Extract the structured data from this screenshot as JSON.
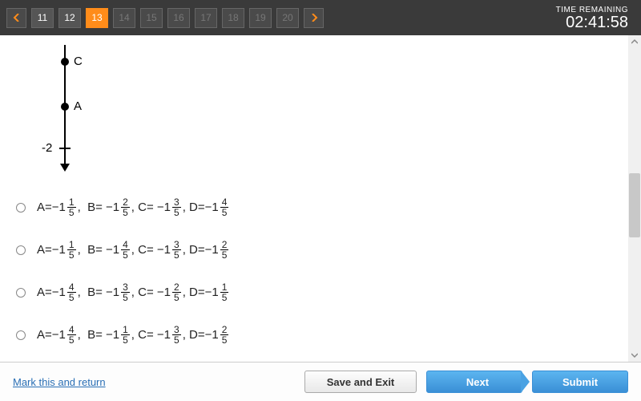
{
  "header": {
    "questions": [
      {
        "num": "11",
        "state": "done"
      },
      {
        "num": "12",
        "state": "done"
      },
      {
        "num": "13",
        "state": "current"
      },
      {
        "num": "14",
        "state": "disabled"
      },
      {
        "num": "15",
        "state": "disabled"
      },
      {
        "num": "16",
        "state": "disabled"
      },
      {
        "num": "17",
        "state": "disabled"
      },
      {
        "num": "18",
        "state": "disabled"
      },
      {
        "num": "19",
        "state": "disabled"
      },
      {
        "num": "20",
        "state": "disabled"
      }
    ],
    "timer_label": "TIME REMAINING",
    "timer_value": "02:41:58"
  },
  "diagram": {
    "point_c": "C",
    "point_a": "A",
    "tick_label": "-2"
  },
  "options": [
    {
      "parts": [
        {
          "prefix": "A=−",
          "whole": "1",
          "num": "1",
          "den": "5"
        },
        {
          "prefix": ",  B= −",
          "whole": "1",
          "num": "2",
          "den": "5"
        },
        {
          "prefix": ", C= −",
          "whole": "1",
          "num": "3",
          "den": "5"
        },
        {
          "prefix": ", D=−",
          "whole": "1",
          "num": "4",
          "den": "5"
        }
      ]
    },
    {
      "parts": [
        {
          "prefix": "A=−",
          "whole": "1",
          "num": "1",
          "den": "5"
        },
        {
          "prefix": ",  B= −",
          "whole": "1",
          "num": "4",
          "den": "5"
        },
        {
          "prefix": ", C= −",
          "whole": "1",
          "num": "3",
          "den": "5"
        },
        {
          "prefix": ", D=−",
          "whole": "1",
          "num": "2",
          "den": "5"
        }
      ]
    },
    {
      "parts": [
        {
          "prefix": "A=−",
          "whole": "1",
          "num": "4",
          "den": "5"
        },
        {
          "prefix": ",  B= −",
          "whole": "1",
          "num": "3",
          "den": "5"
        },
        {
          "prefix": ", C= −",
          "whole": "1",
          "num": "2",
          "den": "5"
        },
        {
          "prefix": ", D=−",
          "whole": "1",
          "num": "1",
          "den": "5"
        }
      ]
    },
    {
      "parts": [
        {
          "prefix": "A=−",
          "whole": "1",
          "num": "4",
          "den": "5"
        },
        {
          "prefix": ",  B= −",
          "whole": "1",
          "num": "1",
          "den": "5"
        },
        {
          "prefix": ", C= −",
          "whole": "1",
          "num": "3",
          "den": "5"
        },
        {
          "prefix": ", D=−",
          "whole": "1",
          "num": "2",
          "den": "5"
        }
      ]
    }
  ],
  "footer": {
    "mark_link": "Mark this and return",
    "save_exit": "Save and Exit",
    "next": "Next",
    "submit": "Submit"
  }
}
